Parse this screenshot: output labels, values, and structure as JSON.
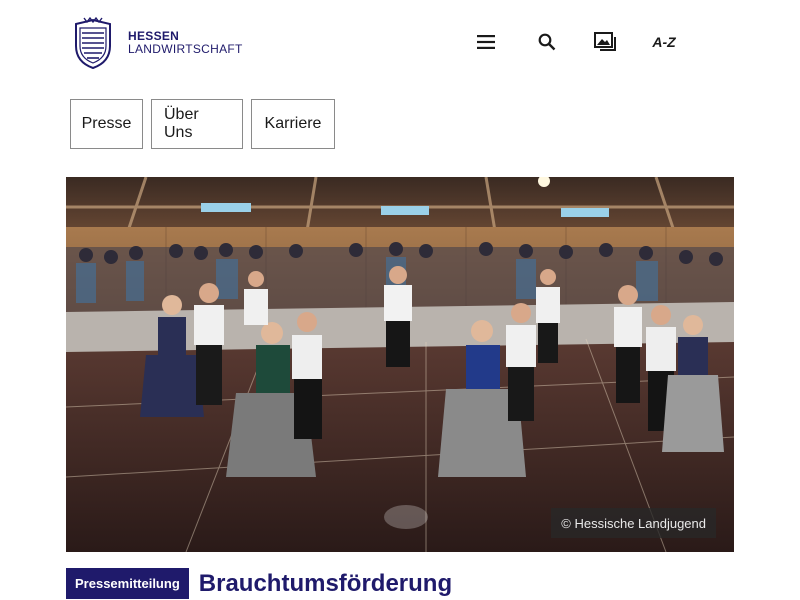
{
  "header": {
    "logo_line1": "HESSEN",
    "logo_line2": "LANDWIRTSCHAFT",
    "icons": [
      "menu-icon",
      "search-icon",
      "image-gallery-icon"
    ],
    "az_label": "A-Z"
  },
  "nav": {
    "items": [
      {
        "label": "Presse"
      },
      {
        "label": "Über Uns"
      },
      {
        "label": "Karriere"
      }
    ]
  },
  "hero": {
    "credit": "© Hessische Landjugend"
  },
  "article": {
    "badge": "Pressemitteilung",
    "title": "Brauchtumsförderung"
  },
  "colors": {
    "brand": "#1f1a6b",
    "credit_bg": "#282828"
  }
}
